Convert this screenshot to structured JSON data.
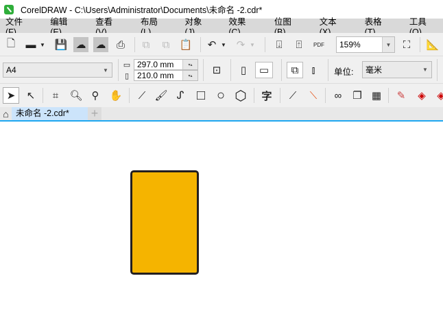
{
  "title_bar": {
    "text": "CorelDRAW - C:\\Users\\Administrator\\Documents\\未命名 -2.cdr*"
  },
  "menu": [
    "文件(F)",
    "编辑(E)",
    "查看(V)",
    "布局(L)",
    "对象(J)",
    "效果(C)",
    "位图(B)",
    "文本(X)",
    "表格(T)",
    "工具(O)"
  ],
  "toolbar": {
    "zoom": "159%",
    "pdf_label": "PDF"
  },
  "property_bar": {
    "page_size": "A4",
    "height": "297.0 mm",
    "width": "210.0 mm",
    "unit_label": "单位:",
    "unit": "毫米"
  },
  "toolbox": {
    "text_tool": "字"
  },
  "tabs": {
    "document": "未命名 -2.cdr*",
    "add": "+"
  },
  "colors": {
    "shape_fill": "#f5b400",
    "shape_outline": "#231f20",
    "tab_active": "#cce4fb",
    "accent": "#1ea7f0"
  }
}
